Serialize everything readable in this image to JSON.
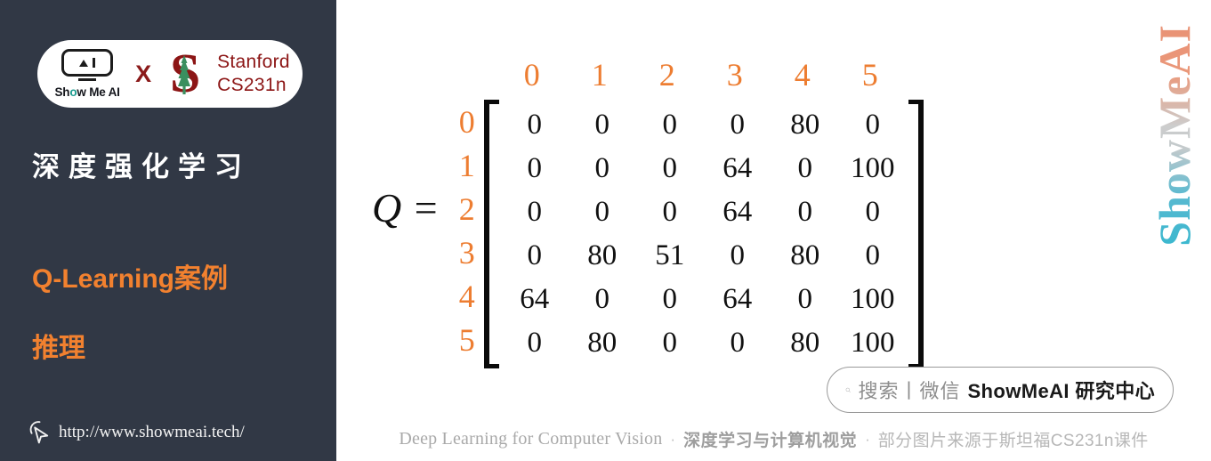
{
  "sidebar": {
    "logo": {
      "smai_icon_name": "showmeai-robot-icon",
      "smai_word_pre": "Sh",
      "smai_word_o": "o",
      "smai_word_post": "w Me AI",
      "cross": "X",
      "stanford_letter": "S",
      "stanford_line1": "Stanford",
      "stanford_line2": "CS231n"
    },
    "course_title": "深度强化学习",
    "topic_line_1": "Q-Learning案例",
    "topic_line_2": "推理",
    "site_url": "http://www.showmeai.tech/",
    "cursor_icon": "cursor-pointer-icon",
    "bg_color": "#313845",
    "accent_color": "#F2812F"
  },
  "main": {
    "q_label": "Q =",
    "wechat": {
      "search_icon": "magnifier-icon",
      "prefix": "搜索丨微信",
      "brand": "ShowMeAI 研究中心"
    },
    "watermark": "ShowMeAI"
  },
  "footer": {
    "english": "Deep Learning for Computer Vision",
    "dot1": "·",
    "chinese_bold": "深度学习与计算机视觉",
    "dot2": "·",
    "chinese_note": "部分图片来源于斯坦福CS231n课件"
  },
  "chart_data": {
    "type": "table",
    "title": "Q =",
    "description": "Q-Learning Q-value matrix, states 0-5 by actions 0-5",
    "row_labels": [
      "0",
      "1",
      "2",
      "3",
      "4",
      "5"
    ],
    "col_labels": [
      "0",
      "1",
      "2",
      "3",
      "4",
      "5"
    ],
    "label_color": "#ED7D31",
    "value_color": "#111111",
    "rows": [
      [
        "0",
        "0",
        "0",
        "0",
        "80",
        "0"
      ],
      [
        "0",
        "0",
        "0",
        "64",
        "0",
        "100"
      ],
      [
        "0",
        "0",
        "0",
        "64",
        "0",
        "0"
      ],
      [
        "0",
        "80",
        "51",
        "0",
        "80",
        "0"
      ],
      [
        "64",
        "0",
        "0",
        "64",
        "0",
        "100"
      ],
      [
        "0",
        "80",
        "0",
        "0",
        "80",
        "100"
      ]
    ]
  }
}
